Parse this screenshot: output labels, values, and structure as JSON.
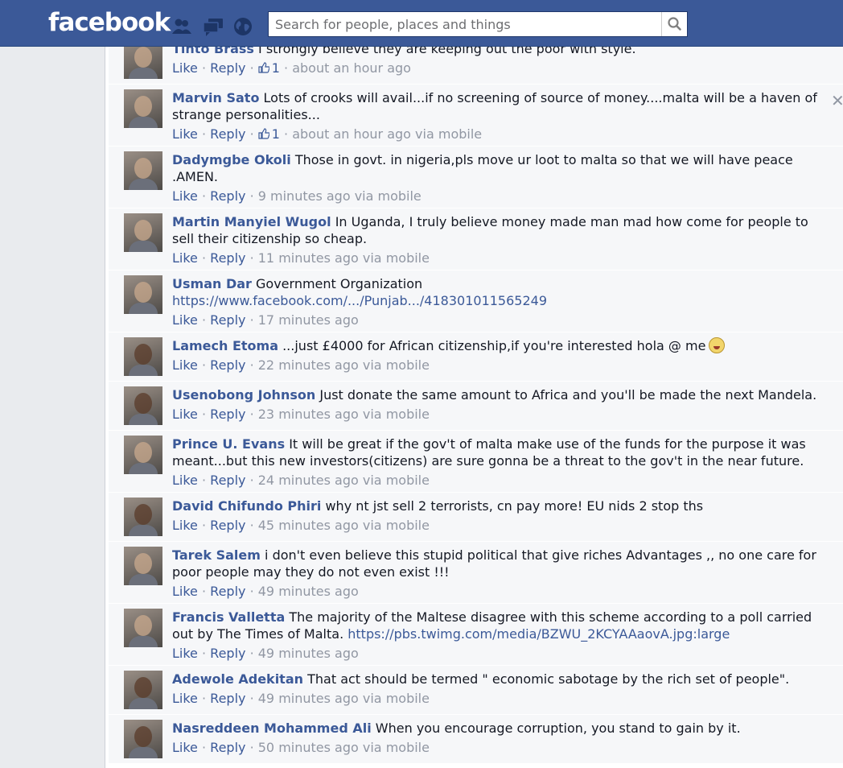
{
  "header": {
    "logo": "facebook",
    "search_placeholder": "Search for people, places and things",
    "icons": [
      "friend-requests-icon",
      "messages-icon",
      "notifications-globe-icon",
      "search-icon"
    ],
    "colors": {
      "bar": "#3b5998",
      "link": "#3b5998",
      "meta": "#9197a3"
    }
  },
  "actions": {
    "like": "Like",
    "reply": "Reply",
    "sep": " · "
  },
  "comments": [
    {
      "author": "Tinto Brass",
      "text": "I strongly believe they are keeping out the poor with style.",
      "likes": "1",
      "time": "about an hour ago"
    },
    {
      "author": "Marvin Sato",
      "text": "Lots of crooks will avail...if no screening of source of money....malta will be a haven of strange personalities...",
      "likes": "1",
      "time": "about an hour ago via mobile"
    },
    {
      "author": "Dadymgbe Okoli",
      "text": "Those in govt. in nigeria,pls move ur loot to malta so that we will have peace .AMEN.",
      "time": "9 minutes ago via mobile"
    },
    {
      "author": "Martin Manyiel Wugol",
      "text": "In Uganda, I truly believe money made man mad how come for people to sell their citizenship so cheap.",
      "time": "11 minutes ago via mobile"
    },
    {
      "author": "Usman Dar",
      "text": "Government Organization",
      "link": "https://www.facebook.com/.../Punjab.../418301011565249",
      "time": "17 minutes ago"
    },
    {
      "author": "Lamech Etoma",
      "text": "...just £4000 for African citizenship,if you're interested hola @ me",
      "emoji": "money-mouth-emoji",
      "time": "22 minutes ago via mobile"
    },
    {
      "author": "Usenobong Johnson",
      "text": "Just donate the same amount to Africa and you'll be made the next Mandela.",
      "time": "23 minutes ago via mobile"
    },
    {
      "author": "Prince U. Evans",
      "text": "It will be great if the gov't of malta make use of the funds for the purpose it was meant...but this new investors(citizens) are sure gonna be a threat to the gov't in the near future.",
      "time": "24 minutes ago via mobile"
    },
    {
      "author": "David Chifundo Phiri",
      "text": "why nt jst sell 2 terrorists, cn pay more! EU nids 2 stop ths",
      "time": "45 minutes ago via mobile"
    },
    {
      "author": "Tarek Salem",
      "text": "i don't even believe this stupid political that give riches Advantages ,, no one care for poor people may they do not even exist !!!",
      "time": "49 minutes ago"
    },
    {
      "author": "Francis Valletta",
      "text": "The majority of the Maltese disagree with this scheme according to a poll carried out by The Times of Malta.",
      "link": "https://pbs.twimg.com/media/BZWU_2KCYAAaovA.jpg:large",
      "time": "49 minutes ago"
    },
    {
      "author": "Adewole Adekitan",
      "text": "That act should be termed \" economic sabotage by the rich set of people\".",
      "time": "49 minutes ago via mobile"
    },
    {
      "author": "Nasreddeen Mohammed Ali",
      "text": "When you encourage corruption, you stand to gain by it.",
      "time": "50 minutes ago via mobile"
    }
  ]
}
